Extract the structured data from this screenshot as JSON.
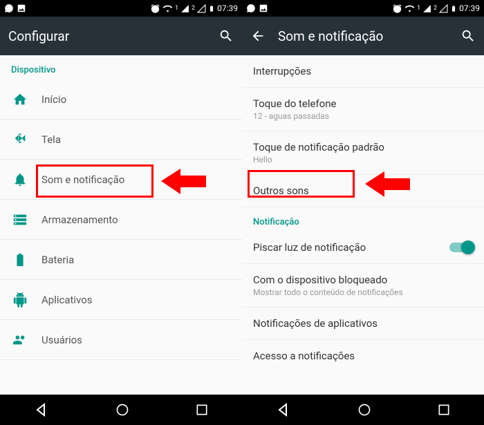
{
  "status": {
    "time": "07:39",
    "wifi_signal": "1",
    "sim2": "2"
  },
  "screen1": {
    "title": "Configurar",
    "section": "Dispositivo",
    "items": [
      {
        "label": "Início"
      },
      {
        "label": "Tela"
      },
      {
        "label": "Som e notificação"
      },
      {
        "label": "Armazenamento"
      },
      {
        "label": "Bateria"
      },
      {
        "label": "Aplicativos"
      },
      {
        "label": "Usuários"
      }
    ]
  },
  "screen2": {
    "title": "Som e notificação",
    "items": {
      "interrupcoes": "Interrupções",
      "toque_title": "Toque do telefone",
      "toque_sub": "12 - aguas passadas",
      "notif_title": "Toque de notificação padrão",
      "notif_sub": "Hello",
      "outros": "Outros sons"
    },
    "section2": "Notificação",
    "items2": {
      "piscar": "Piscar luz de notificação",
      "bloqueado_title": "Com o dispositivo bloqueado",
      "bloqueado_sub": "Mostrar todo o conteúdo de notificações",
      "notif_apps": "Notificações de aplicativos",
      "acesso": "Acesso a notificações"
    }
  }
}
